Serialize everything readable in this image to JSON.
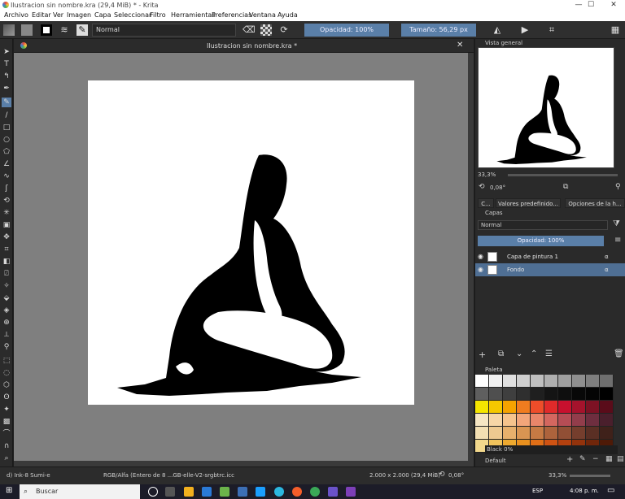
{
  "window": {
    "title": "Ilustracion sin nombre.kra (29,4 MiB)  * - Krita",
    "minimize": "—",
    "maximize": "☐",
    "close": "✕"
  },
  "menu": [
    "Archivo",
    "Editar",
    "Ver",
    "Imagen",
    "Capa",
    "Seleccionar",
    "Filtro",
    "Herramientas",
    "Preferencias",
    "Ventana",
    "Ayuda"
  ],
  "toolbar": {
    "blend_mode": "Normal",
    "opacity": "Opacidad: 100%",
    "size": "Tamaño: 56,29 px"
  },
  "document": {
    "tab_title": "Ilustracion sin nombre.kra *",
    "close": "✕"
  },
  "overview": {
    "title": "Vista general",
    "zoom": "33,3%",
    "rotation": "0,08°"
  },
  "docker_tabs": [
    "C...",
    "Valores predefinido...",
    "Opciones de la h..."
  ],
  "layers": {
    "title": "Capas",
    "blend_mode": "Normal",
    "opacity": "Opacidad:  100%",
    "items": [
      {
        "name": "Capa de pintura 1",
        "alpha": "α"
      },
      {
        "name": "Fondo",
        "alpha": "α"
      }
    ]
  },
  "palette": {
    "title": "Paleta",
    "current": "Black 0%",
    "set": "Default",
    "zoom": "33,3%",
    "rows": [
      [
        "#ffffff",
        "#f0f0f0",
        "#e0e0e0",
        "#cfcfcf",
        "#bfbfbf",
        "#afafaf",
        "#9f9f9f",
        "#8f8f8f",
        "#7f7f7f",
        "#6f6f6f"
      ],
      [
        "#5f5f5f",
        "#4f4f4f",
        "#3f3f3f",
        "#2f2f2f",
        "#1f1f1f",
        "#141414",
        "#0f0f0f",
        "#080808",
        "#040404",
        "#000000"
      ],
      [
        "#f5e600",
        "#f5c800",
        "#f5a300",
        "#f07c1f",
        "#ee4d2a",
        "#e02a2a",
        "#c8102e",
        "#a5132c",
        "#7d1224",
        "#5a0c1a"
      ],
      [
        "#f6e6c4",
        "#f7d6a7",
        "#f6c48d",
        "#f2a67a",
        "#e9866a",
        "#d4675f",
        "#b64d55",
        "#923d4b",
        "#6e2e3f",
        "#4a1f2c"
      ],
      [
        "#f3dfb3",
        "#eec990",
        "#e7b06c",
        "#d99552",
        "#c67a44",
        "#ad633c",
        "#914f35",
        "#753e2d",
        "#5a2f24",
        "#3f211a"
      ],
      [
        "#f2d88c",
        "#f0c35c",
        "#eda92f",
        "#e9901e",
        "#e06f17",
        "#cf5313",
        "#b4410f",
        "#93330c",
        "#70260a",
        "#4e1a07"
      ]
    ]
  },
  "status": {
    "brush": "d) Ink-8 Sumi-e",
    "color_space": "RGB/Alfa (Entero de 8 ...GB-elle-V2-srgbtrc.icc",
    "dimensions": "2.000 x 2.000 (29,4 MiB)",
    "rotation": "0,08°",
    "zoom": "33,3%"
  },
  "taskbar": {
    "search": "Buscar",
    "lang": "ESP",
    "time": "4:08 p. m."
  },
  "colors": {
    "accent": "#5a7fa8",
    "canvas_bg": "#7f7f7f",
    "panel": "#2a2a2a"
  }
}
